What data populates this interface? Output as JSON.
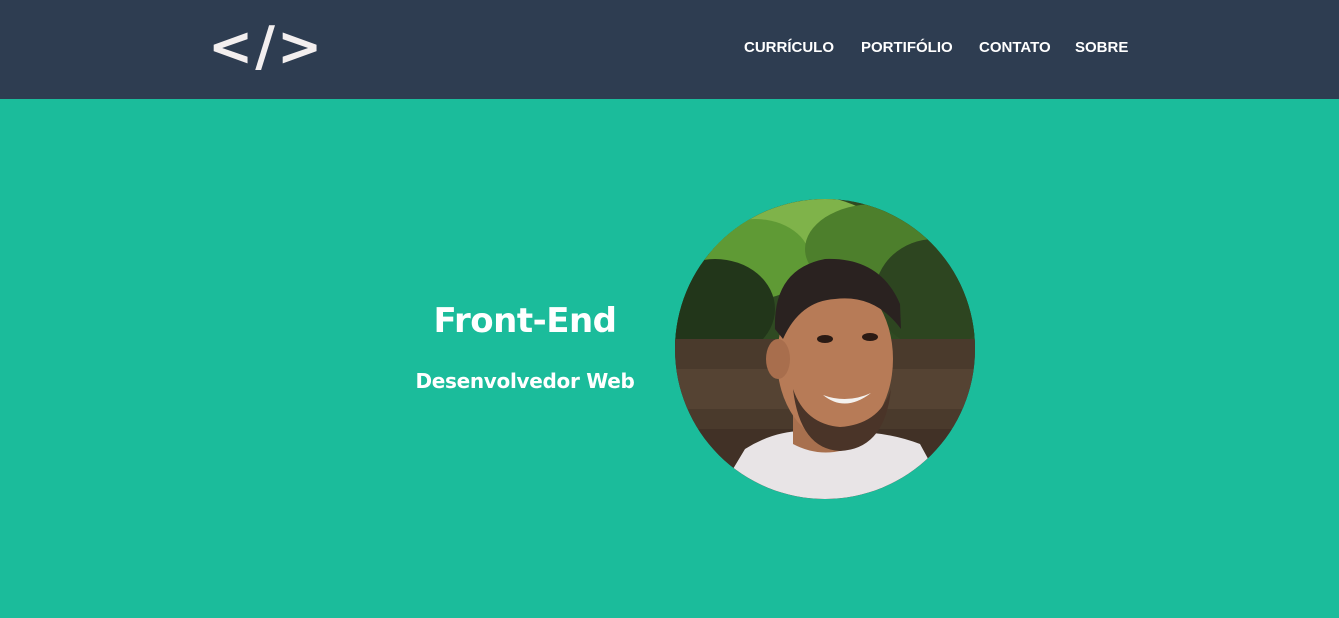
{
  "header": {
    "logo_text": "</>",
    "nav": [
      {
        "label": "CURRÍCULO"
      },
      {
        "label": "PORTIFÓLIO"
      },
      {
        "label": "CONTATO"
      },
      {
        "label": "SOBRE"
      }
    ]
  },
  "hero": {
    "title": "Front-End",
    "subtitle": "Desenvolvedor Web"
  },
  "colors": {
    "header_bg": "#2e3d51",
    "hero_bg": "#1bbc9b",
    "text": "#ffffff"
  }
}
